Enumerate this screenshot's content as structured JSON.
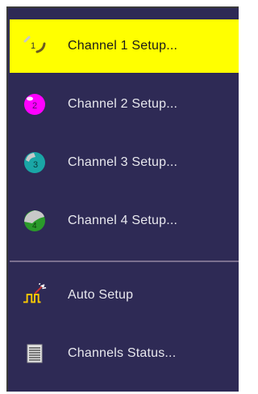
{
  "menu": {
    "items": [
      {
        "label": "Channel 1 Setup...",
        "icon": "channel-1-icon",
        "selected": true,
        "badge": "1"
      },
      {
        "label": "Channel 2 Setup...",
        "icon": "channel-2-icon",
        "selected": false,
        "badge": "2"
      },
      {
        "label": "Channel 3 Setup...",
        "icon": "channel-3-icon",
        "selected": false,
        "badge": "3"
      },
      {
        "label": "Channel 4 Setup...",
        "icon": "channel-4-icon",
        "selected": false,
        "badge": "4"
      }
    ],
    "actions": [
      {
        "label": "Auto Setup",
        "icon": "auto-setup-icon"
      },
      {
        "label": "Channels Status...",
        "icon": "channels-status-icon"
      }
    ]
  },
  "colors": {
    "menu_bg": "#2e2a55",
    "selected_bg": "#ffff00",
    "ch2": "#ff00ff",
    "ch3": "#1aa6a6",
    "ch4": "#2a9a2a"
  }
}
